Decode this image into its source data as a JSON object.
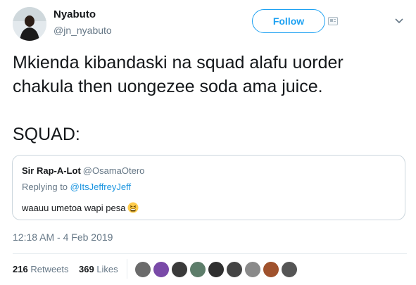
{
  "author": {
    "display_name": "Nyabuto",
    "handle": "@jn_nyabuto"
  },
  "actions": {
    "follow_label": "Follow"
  },
  "tweet": {
    "text": "Mkienda kibandaski na squad alafu uorder\nchakula then uongezee soda ama juice.\n\nSQUAD:",
    "timestamp": "12:18 AM - 4 Feb 2019"
  },
  "quoted_tweet": {
    "display_name": "Sir Rap-A-Lot",
    "handle": "@OsamaOtero",
    "replying_label": "Replying to",
    "replying_to": "@ItsJeffreyJeff",
    "text": "waauu umetoa wapi pesa",
    "emoji": "tired-face-emoji"
  },
  "stats": {
    "retweets_count": "216",
    "retweets_label": "Retweets",
    "likes_count": "369",
    "likes_label": "Likes"
  },
  "likers": [
    {
      "color": "#6b6b6b"
    },
    {
      "color": "#7a4aa8"
    },
    {
      "color": "#3a3a3a"
    },
    {
      "color": "#5d7d6a"
    },
    {
      "color": "#2f2f2f"
    },
    {
      "color": "#444444"
    },
    {
      "color": "#8a8a8a"
    },
    {
      "color": "#a0522d"
    },
    {
      "color": "#555555"
    }
  ],
  "colors": {
    "accent": "#1da1f2",
    "secondary_text": "#657786",
    "border": "#ccd6dd"
  }
}
